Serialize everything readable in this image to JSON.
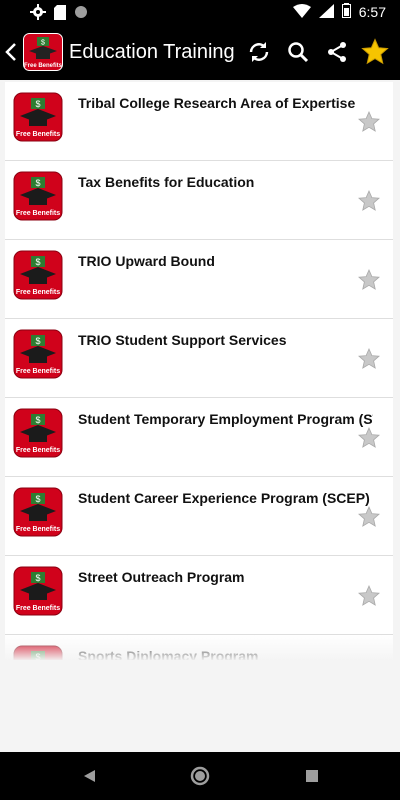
{
  "status_bar": {
    "time": "6:57",
    "icons": [
      "gear-icon",
      "sd-card-icon",
      "circle-icon",
      "wifi-icon",
      "signal-icon",
      "battery-icon"
    ]
  },
  "app_bar": {
    "title": "Education    Training",
    "logo_text": "Free Benefits",
    "actions": [
      "refresh-icon",
      "search-icon",
      "share-icon",
      "star-icon"
    ],
    "accent_star": "#f6c400"
  },
  "list": {
    "item_icon_text": "Free Benefits",
    "items": [
      {
        "label": "Tribal College Research Area of Expertise"
      },
      {
        "label": "Tax Benefits for Education"
      },
      {
        "label": "TRIO Upward Bound"
      },
      {
        "label": "TRIO Student Support Services"
      },
      {
        "label": "Student Temporary Employment Program (STEP)"
      },
      {
        "label": "Student Career Experience Program (SCEP)"
      },
      {
        "label": "Street Outreach Program"
      },
      {
        "label": "Sports Diplomacy Program"
      }
    ]
  },
  "nav_bar": {
    "buttons": [
      "back-triangle-icon",
      "home-circle-icon",
      "recents-square-icon"
    ]
  },
  "colors": {
    "bar": "#000000",
    "background": "#f4f4f4",
    "icon_red": "#d0021b",
    "star_grey": "#bdbdbd"
  }
}
